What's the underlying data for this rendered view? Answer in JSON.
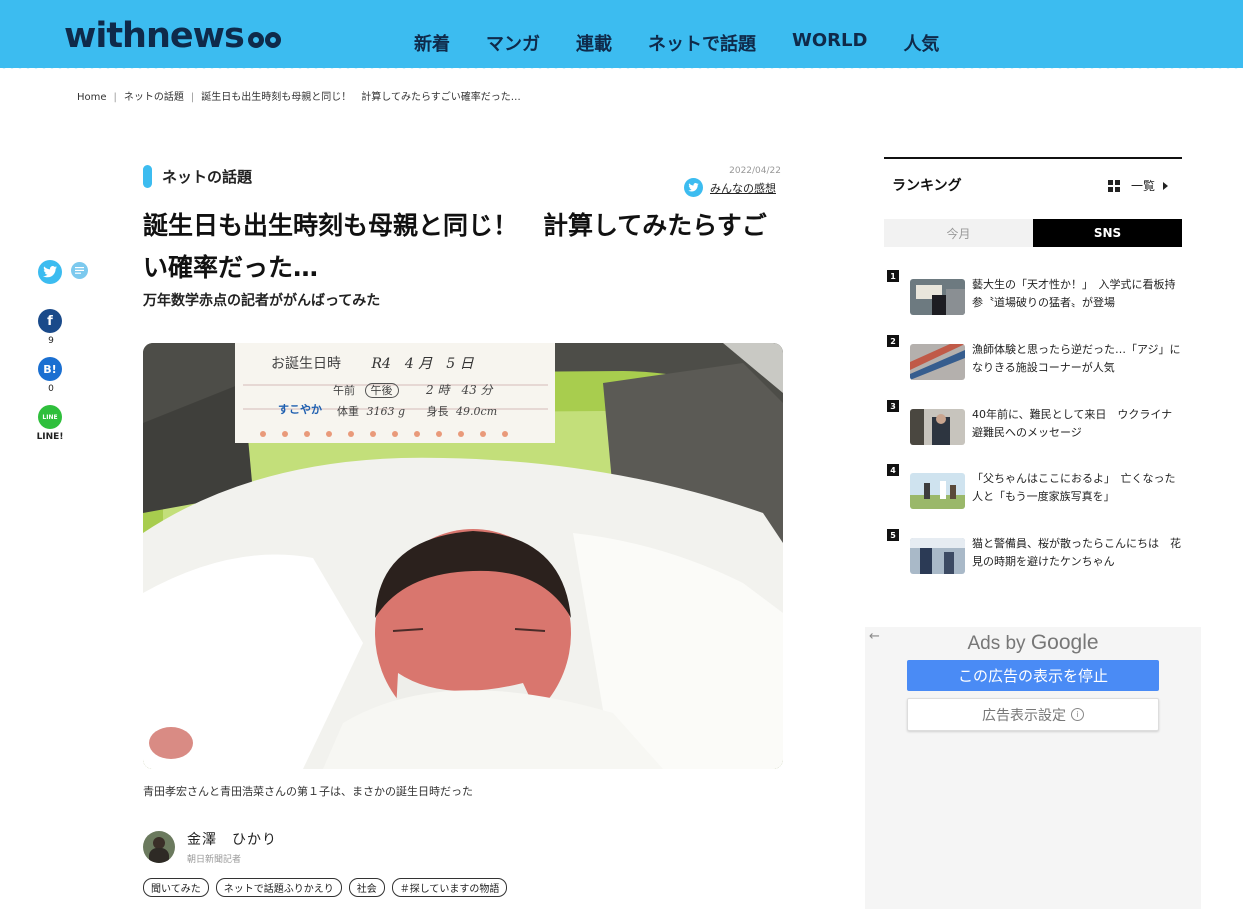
{
  "header": {
    "logo": "withnews",
    "nav": [
      "新着",
      "マンガ",
      "連載",
      "ネットで話題",
      "WORLD",
      "人気"
    ]
  },
  "breadcrumb": {
    "home": "Home",
    "category": "ネットの話題",
    "current": "誕生日も出生時刻も母親と同じ！　計算してみたらすごい確率だった…"
  },
  "share": {
    "facebook_count": "9",
    "hatena_count": "0",
    "line_label": "LINE!"
  },
  "article": {
    "category": "ネットの話題",
    "date": "2022/04/22",
    "impressions_label": "みんなの感想",
    "title": "誕生日も出生時刻も母親と同じ！　計算してみたらすごい確率だった…",
    "subtitle": "万年数学赤点の記者ががんばってみた",
    "caption": "青田孝宏さんと青田浩菜さんの第１子は、まさかの誕生日時だった",
    "author_name": "金澤　ひかり",
    "author_org": "朝日新聞記者",
    "tags": [
      "聞いてみた",
      "ネットで話題ふりかえり",
      "社会",
      "＃探していますの物語"
    ]
  },
  "photo_card": {
    "birthday_label": "お誕生日時",
    "birthday_value": "R4　4 月　5 日",
    "time_label": "午前",
    "time_pm": "午後",
    "time_value": "2 時　43 分",
    "brand": "すこやか",
    "weight_label": "体重",
    "weight_value": "3163 g",
    "height_label": "身長",
    "height_value": "49.0cm"
  },
  "ranking": {
    "title": "ランキング",
    "list_link": "一覧",
    "tabs": [
      "今月",
      "SNS"
    ],
    "active_tab": "SNS",
    "items": [
      {
        "num": "1",
        "text": "藝大生の「天才性か！」　入学式に看板持参〝道場破りの猛者〟が登場"
      },
      {
        "num": "2",
        "text": "漁師体験と思ったら逆だった…「アジ」になりきる施設コーナーが人気"
      },
      {
        "num": "3",
        "text": "40年前に、難民として来日　ウクライナ避難民へのメッセージ"
      },
      {
        "num": "4",
        "text": "「父ちゃんはここにおるよ」　亡くなった人と「もう一度家族写真を」"
      },
      {
        "num": "5",
        "text": "猫と警備員、桜が散ったらこんにちは　花見の時期を避けたケンちゃん"
      }
    ]
  },
  "ad": {
    "ads_by": "Ads by",
    "google": "Google",
    "stop_button": "この広告の表示を停止",
    "settings_button": "広告表示設定"
  },
  "colors": {
    "brand": "#3cbcf0",
    "navy": "#0f2a4a",
    "ad_blue": "#4a8bf5"
  }
}
